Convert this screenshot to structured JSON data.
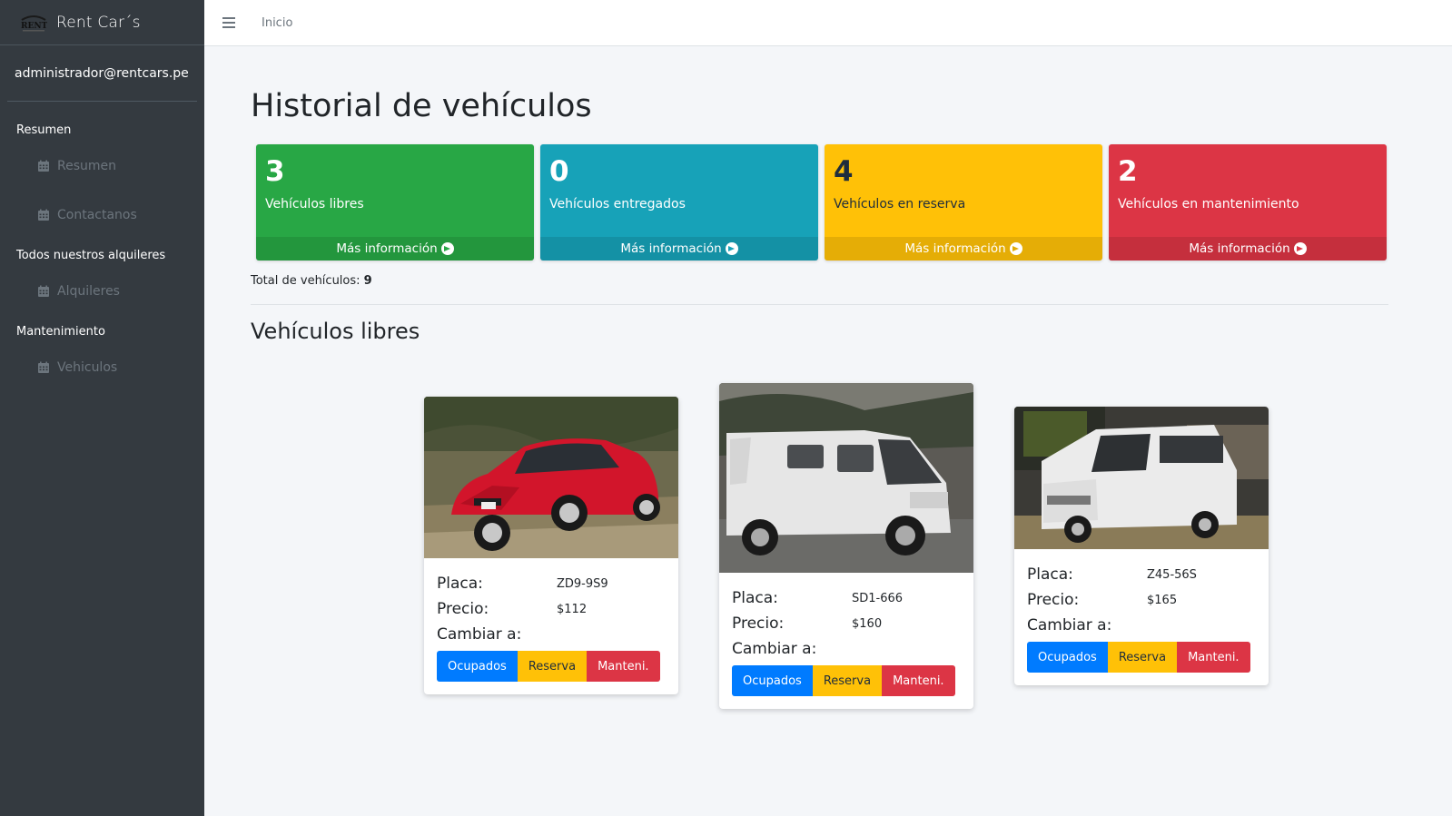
{
  "sidebar": {
    "brand": "Rent Car´s",
    "logo_text": "RENT",
    "user": "administrador@rentcars.pe",
    "sections": [
      {
        "header": "Resumen",
        "items": [
          "Resumen",
          "Contactanos"
        ]
      },
      {
        "header": "Todos nuestros alquileres",
        "items": [
          "Alquileres"
        ]
      },
      {
        "header": "Mantenimiento",
        "items": [
          "Vehiculos"
        ]
      }
    ]
  },
  "topbar": {
    "link": "Inicio"
  },
  "main": {
    "title": "Historial de vehículos",
    "boxes": [
      {
        "count": "3",
        "label": "Vehículos libres",
        "footer": "Más información",
        "color": "#28a745"
      },
      {
        "count": "0",
        "label": "Vehículos entregados",
        "footer": "Más información",
        "color": "#17a2b8"
      },
      {
        "count": "4",
        "label": "Vehículos en reserva",
        "footer": "Más información",
        "color": "#ffc107"
      },
      {
        "count": "2",
        "label": "Vehículos en mantenimiento",
        "footer": "Más información",
        "color": "#dc3545"
      }
    ],
    "total_label": "Total de vehículos:",
    "total_value": "9",
    "section_title": "Vehículos libres",
    "labels": {
      "plate": "Placa:",
      "price": "Precio:",
      "change": "Cambiar a:"
    },
    "buttons": {
      "occupied": "Ocupados",
      "reserve": "Reserva",
      "maintenance": "Manteni."
    },
    "vehicles": [
      {
        "plate": "ZD9-9S9",
        "price": "$112",
        "image": "red-hatchback-car"
      },
      {
        "plate": "SD1-666",
        "price": "$160",
        "image": "white-cargo-van"
      },
      {
        "plate": "Z45-56S",
        "price": "$165",
        "image": "white-minibus"
      }
    ]
  }
}
